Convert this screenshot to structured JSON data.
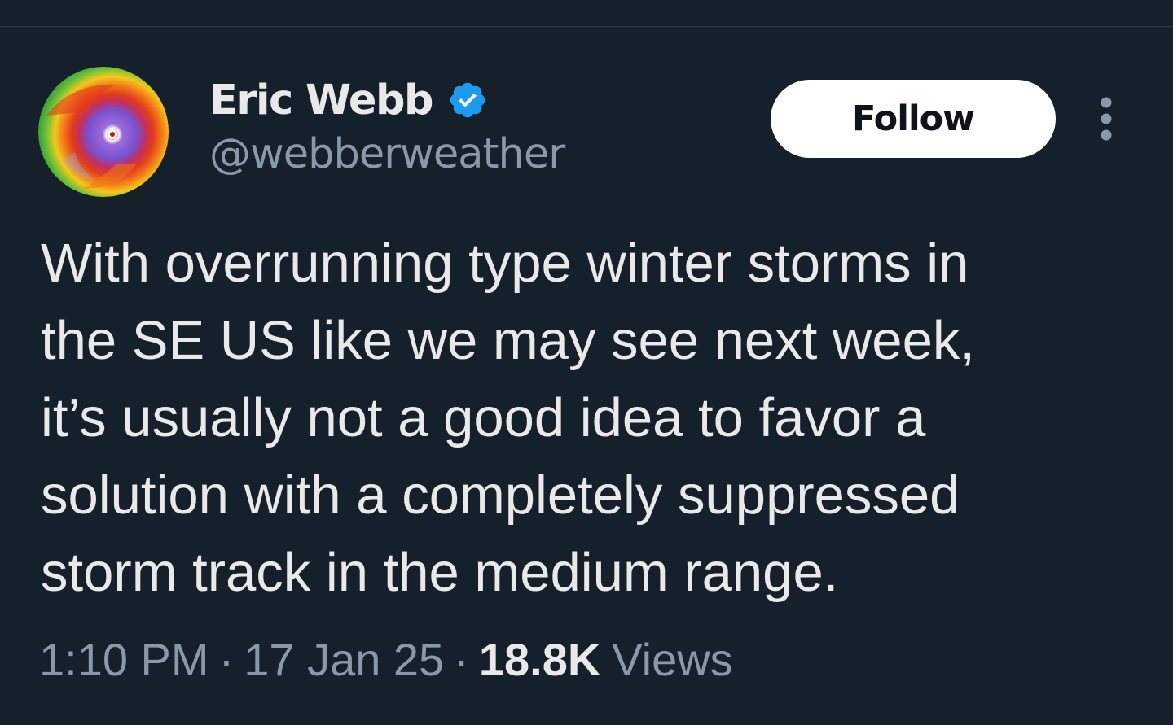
{
  "tweet": {
    "author": {
      "display_name": "Eric Webb",
      "handle": "@webberweather",
      "verified": true,
      "avatar_icon": "hurricane-radar-avatar"
    },
    "follow_label": "Follow",
    "more_icon": "more-vertical-icon",
    "text_lines": [
      "With overrunning type winter storms in",
      "the SE US like we may see next week,",
      "it’s usually not a good idea to favor a",
      "solution with a completely suppressed",
      "storm track in the medium range."
    ],
    "time": "1:10 PM",
    "date": "17 Jan 25",
    "separator": "·",
    "views_count": "18.8K",
    "views_label": "Views"
  },
  "colors": {
    "background": "#16202b",
    "primary_text": "#e7e9ea",
    "secondary_text": "#8b98a5",
    "verified_badge": "#1d9bf0",
    "follow_button_bg": "#ffffff",
    "follow_button_text": "#0f1419"
  }
}
